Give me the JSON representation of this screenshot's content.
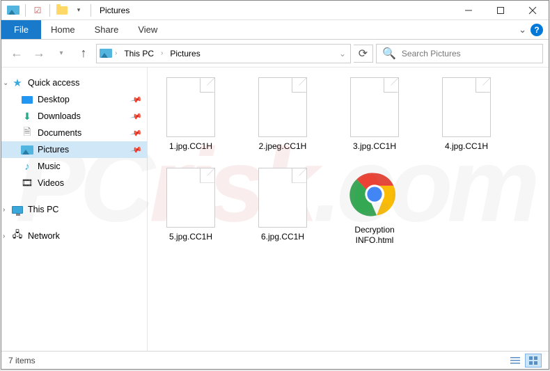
{
  "title": "Pictures",
  "ribbon": {
    "file": "File",
    "tabs": [
      "Home",
      "Share",
      "View"
    ]
  },
  "breadcrumb": {
    "items": [
      "This PC",
      "Pictures"
    ]
  },
  "search": {
    "placeholder": "Search Pictures"
  },
  "navpane": {
    "quick_access": {
      "label": "Quick access",
      "items": [
        {
          "label": "Desktop",
          "icon": "desktop",
          "pinned": true
        },
        {
          "label": "Downloads",
          "icon": "downloads",
          "pinned": true
        },
        {
          "label": "Documents",
          "icon": "document",
          "pinned": true
        },
        {
          "label": "Pictures",
          "icon": "pictures",
          "pinned": true,
          "selected": true
        },
        {
          "label": "Music",
          "icon": "music",
          "pinned": false
        },
        {
          "label": "Videos",
          "icon": "videos",
          "pinned": false
        }
      ]
    },
    "this_pc": {
      "label": "This PC"
    },
    "network": {
      "label": "Network"
    }
  },
  "files": [
    {
      "name": "1.jpg.CC1H",
      "type": "blank"
    },
    {
      "name": "2.jpeg.CC1H",
      "type": "blank"
    },
    {
      "name": "3.jpg.CC1H",
      "type": "blank"
    },
    {
      "name": "4.jpg.CC1H",
      "type": "blank"
    },
    {
      "name": "5.jpg.CC1H",
      "type": "blank"
    },
    {
      "name": "6.jpg.CC1H",
      "type": "blank"
    },
    {
      "name": "Decryption INFO.html",
      "type": "chrome"
    }
  ],
  "status": {
    "count": "7 items"
  }
}
